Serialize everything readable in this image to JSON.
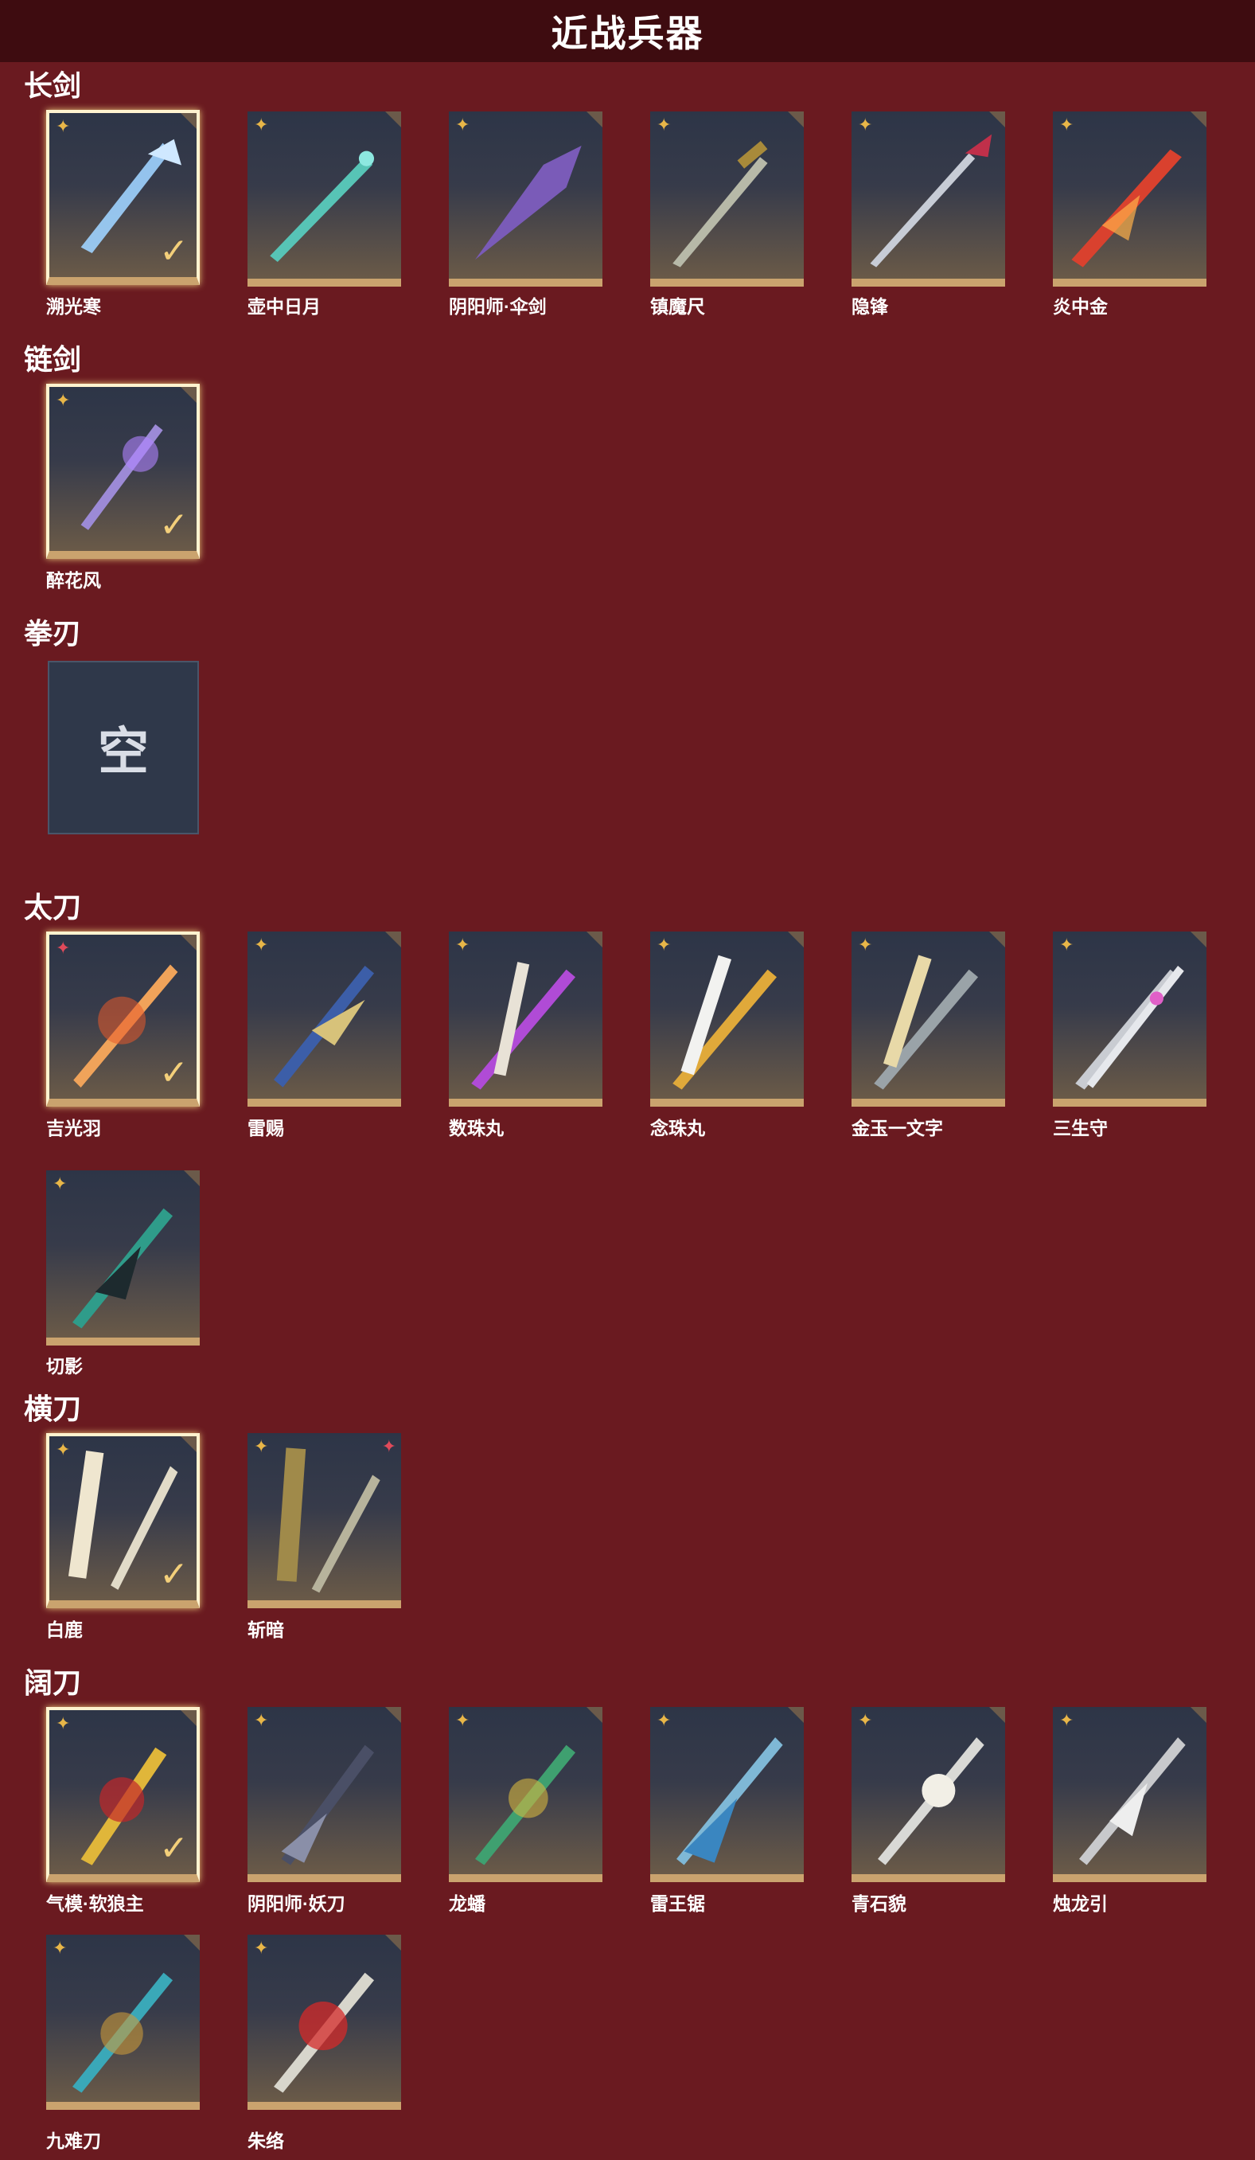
{
  "header": {
    "title": "近战兵器"
  },
  "sections": [
    {
      "name": "长剑",
      "items": [
        "溯光寒",
        "壶中日月",
        "阴阳师·伞剑",
        "镇魔尺",
        "隐锋",
        "炎中金"
      ]
    },
    {
      "name": "链剑",
      "items": [
        "醉花风"
      ]
    },
    {
      "name": "拳刃",
      "items": [],
      "empty_label": "空"
    },
    {
      "name": "太刀",
      "items": [
        "吉光羽",
        "雷赐",
        "数珠丸",
        "念珠丸",
        "金玉一文字",
        "三生守",
        "切影"
      ]
    },
    {
      "name": "横刀",
      "items": [
        "白鹿",
        "斩暗"
      ]
    },
    {
      "name": "阔刀",
      "items": [
        "气模·软狼主",
        "阴阳师·妖刀",
        "龙蟠",
        "雷王锯",
        "青石貌",
        "烛龙引",
        "九难刀",
        "朱络"
      ]
    }
  ],
  "icons": {
    "rank": "star-icon",
    "equipped": "checkmark-icon",
    "empty": "empty-slot-icon"
  },
  "colors": {
    "background": "#6a1a20",
    "header": "#3e0c10",
    "accent_gold": "#caa36e",
    "card": "#2d3547"
  }
}
